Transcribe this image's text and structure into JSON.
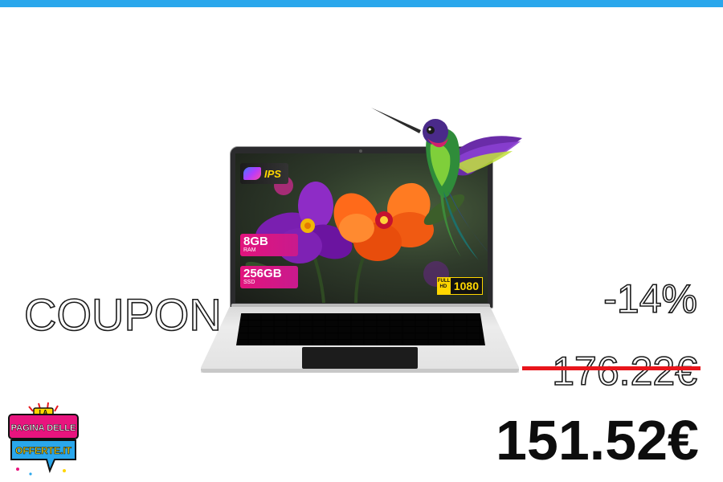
{
  "promo": {
    "coupon_label": "COUPON",
    "discount": "-14%",
    "old_price": "176.22€",
    "new_price": "151.52€"
  },
  "product_image": {
    "screen_badges": {
      "panel": "IPS",
      "ram_size": "8GB",
      "ram_label": "RAM",
      "ssd_size": "256GB",
      "ssd_label": "SSD",
      "fhd_label_line1": "FULL",
      "fhd_label_line2": "HD",
      "resolution": "1080"
    }
  },
  "logo": {
    "line1": "LA",
    "line2": "PAGINA DELLE",
    "line3": "OFFERTE.IT"
  },
  "colors": {
    "top_bar": "#2aa7ec",
    "strike": "#e8151b",
    "badge_pink": "#e2147d",
    "badge_yellow": "#ffd600"
  }
}
